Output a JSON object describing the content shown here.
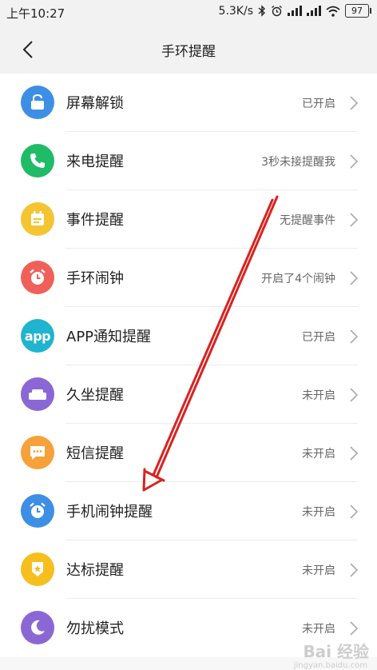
{
  "status_bar": {
    "time": "上午10:27",
    "network_speed": "5.3K/s",
    "battery": "97",
    "icons": [
      "bluetooth-icon",
      "alarm-icon",
      "signal-icon",
      "signal-icon",
      "wifi-icon",
      "battery-icon"
    ]
  },
  "header": {
    "title": "手环提醒",
    "back_icon": "chevron-left-icon"
  },
  "reminders": [
    {
      "label": "屏幕解锁",
      "status": "已开启",
      "icon": "lock-icon",
      "color": "#3d8fe6"
    },
    {
      "label": "来电提醒",
      "status": "3秒未接提醒我",
      "icon": "phone-icon",
      "color": "#1fbb67"
    },
    {
      "label": "事件提醒",
      "status": "无提醒事件",
      "icon": "calendar-icon",
      "color": "#f5c431"
    },
    {
      "label": "手环闹钟",
      "status": "开启了4个闹钟",
      "icon": "alarm-clock-icon",
      "color": "#f0605a"
    },
    {
      "label": "APP通知提醒",
      "status": "已开启",
      "icon": "app-icon",
      "icon_text": "app",
      "color": "#1fb4cf"
    },
    {
      "label": "久坐提醒",
      "status": "未开启",
      "icon": "sofa-icon",
      "color": "#8b67d6"
    },
    {
      "label": "短信提醒",
      "status": "未开启",
      "icon": "message-icon",
      "color": "#f6a13a"
    },
    {
      "label": "手机闹钟提醒",
      "status": "未开启",
      "icon": "alarm-clock-icon",
      "color": "#3d8fe6"
    },
    {
      "label": "达标提醒",
      "status": "未开启",
      "icon": "badge-icon",
      "color": "#f6bf1d"
    },
    {
      "label": "勿扰模式",
      "status": "未开启",
      "icon": "moon-icon",
      "color": "#8b67d6"
    }
  ],
  "watermark": {
    "text": "Bai 经验",
    "sub": "jingyan.baidu.com"
  },
  "colors": {
    "annotation_arrow": "#d9221f"
  }
}
